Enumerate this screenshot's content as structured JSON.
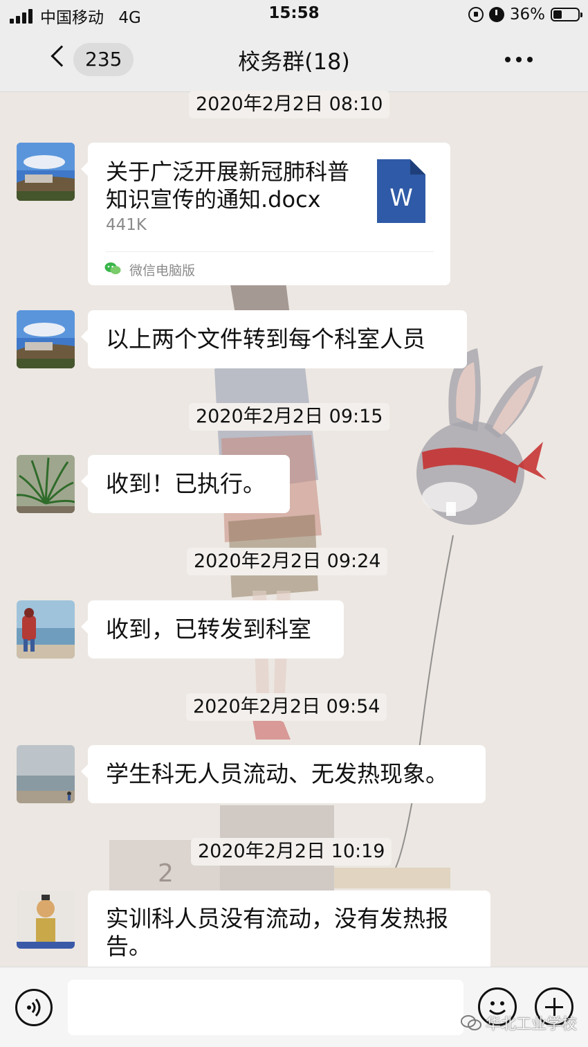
{
  "status_bar": {
    "carrier": "中国移动",
    "network": "4G",
    "time": "15:58",
    "battery_percent": "36%",
    "battery_level": 0.36
  },
  "nav": {
    "unread_count": "235",
    "title": "校务群(18)"
  },
  "messages": [
    {
      "timestamp": "2020年2月2日 08:10",
      "type": "file",
      "file_name": "关于广泛开展新冠肺科普知识宣传的通知.docx",
      "file_size": "441K",
      "file_icon": "word-doc-icon",
      "file_icon_letter": "W",
      "source": "微信电脑版"
    },
    {
      "type": "text",
      "text": "以上两个文件转到每个科室人员"
    },
    {
      "timestamp": "2020年2月2日 09:15",
      "type": "text",
      "text": "收到！已执行。"
    },
    {
      "timestamp": "2020年2月2日 09:24",
      "type": "text",
      "text": "收到，已转发到科室"
    },
    {
      "timestamp": "2020年2月2日 09:54",
      "type": "text",
      "text": "学生科无人员流动、无发热现象。"
    },
    {
      "timestamp": "2020年2月2日 10:19",
      "type": "text",
      "text": "实训科人员没有流动，没有发热报告。"
    }
  ],
  "input_bar": {
    "value": "",
    "watermark": "华北工业学校"
  },
  "colors": {
    "chat_background": "#ece7e2",
    "bubble": "#ffffff",
    "bar": "#ededed",
    "word_icon": "#2f5aa7",
    "wechat_green": "#07c160"
  }
}
